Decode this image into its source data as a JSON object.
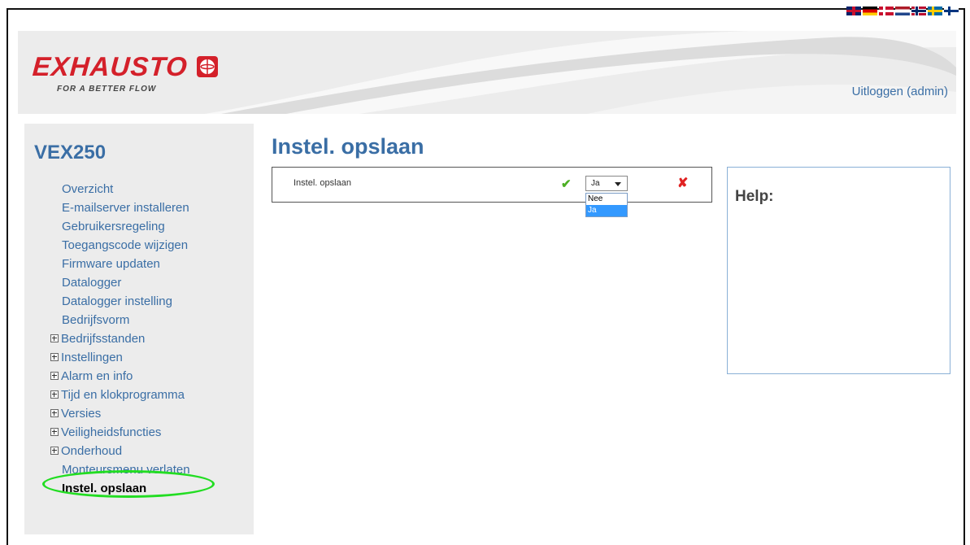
{
  "languages": [
    {
      "icon": "flag-en-icon"
    },
    {
      "icon": "flag-de-icon"
    },
    {
      "icon": "flag-dk-icon"
    },
    {
      "icon": "flag-nl-icon"
    },
    {
      "icon": "flag-no-icon"
    },
    {
      "icon": "flag-se-icon"
    },
    {
      "icon": "flag-fi-icon"
    }
  ],
  "header": {
    "brand": "EXHAUSTO",
    "tagline": "FOR A BETTER FLOW",
    "logout_label": "Uitloggen (admin)"
  },
  "sidebar": {
    "device": "VEX250",
    "items": [
      {
        "label": "Overzicht"
      },
      {
        "label": "E-mailserver installeren"
      },
      {
        "label": "Gebruikersregeling"
      },
      {
        "label": "Toegangscode wijzigen"
      },
      {
        "label": "Firmware updaten"
      },
      {
        "label": "Datalogger"
      },
      {
        "label": "Datalogger instelling"
      },
      {
        "label": "Bedrijfsvorm"
      },
      {
        "label": "Bedrijfsstanden"
      },
      {
        "label": "Instellingen"
      },
      {
        "label": "Alarm en info"
      },
      {
        "label": "Tijd en klokprogramma"
      },
      {
        "label": "Versies"
      },
      {
        "label": "Veiligheidsfuncties"
      },
      {
        "label": "Onderhoud"
      },
      {
        "label": "Monteursmenu verlaten"
      },
      {
        "label": "Instel. opslaan"
      }
    ]
  },
  "main": {
    "title": "Instel. opslaan",
    "setting": {
      "label": "Instel. opslaan",
      "selected": "Ja",
      "options": [
        "Nee",
        "Ja"
      ]
    }
  },
  "help": {
    "title": "Help:"
  },
  "colors": {
    "accent": "#3a6ea5",
    "brand_red": "#d4202a",
    "highlight": "#22dd22",
    "ok": "#4caf24",
    "cancel": "#e02222"
  }
}
